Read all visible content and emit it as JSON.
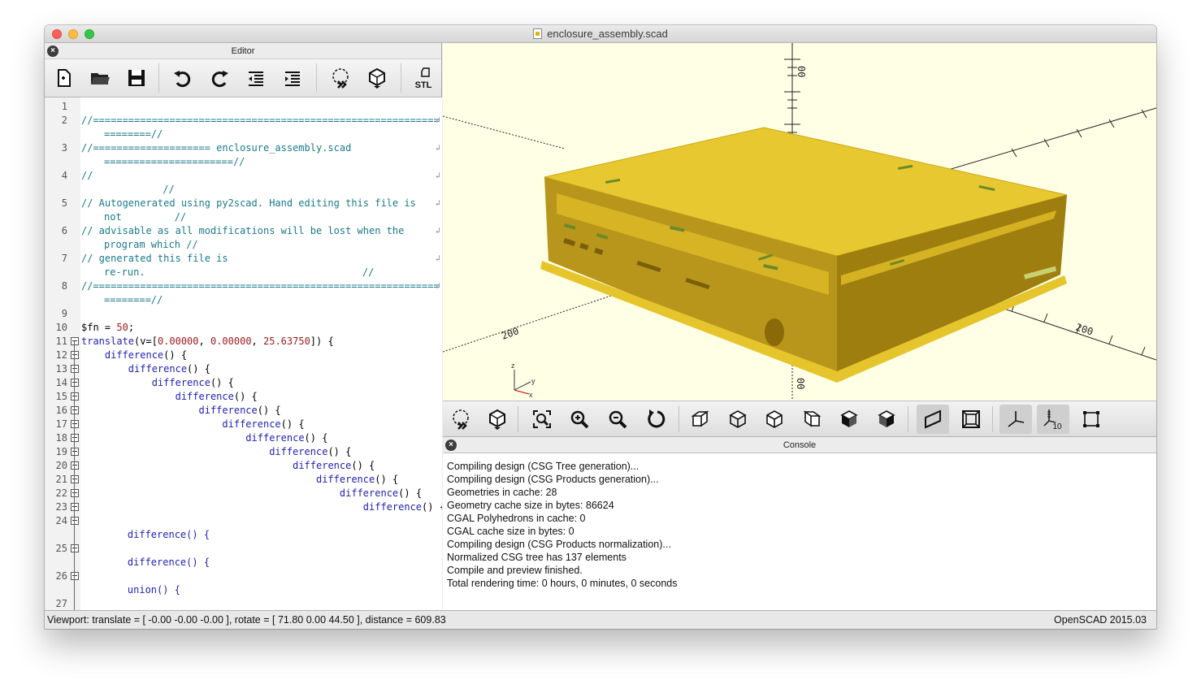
{
  "window": {
    "title": "enclosure_assembly.scad"
  },
  "editor": {
    "header": "Editor",
    "toolbar": [
      {
        "name": "new-file-icon"
      },
      {
        "name": "open-file-icon"
      },
      {
        "name": "save-icon"
      },
      {
        "name": "undo-icon"
      },
      {
        "name": "redo-icon"
      },
      {
        "name": "unindent-icon"
      },
      {
        "name": "indent-icon"
      },
      {
        "name": "preview-icon"
      },
      {
        "name": "render-icon"
      },
      {
        "name": "export-stl-icon",
        "label": "STL"
      }
    ],
    "lines": [
      {
        "n": "1",
        "text": ""
      },
      {
        "n": "2",
        "text": "//===========================================================",
        "cls": "cm",
        "wrap": "========//"
      },
      {
        "n": "3",
        "text": "//==================== enclosure_assembly.scad",
        "cls": "cm",
        "wrap": "======================//"
      },
      {
        "n": "4",
        "text": "//",
        "cls": "cm",
        "wrap": "          //"
      },
      {
        "n": "5",
        "text": "// Autogenerated using py2scad. Hand editing this file is",
        "cls": "cm",
        "wrap": "not         //"
      },
      {
        "n": "6",
        "text": "// advisable as all modifications will be lost when the",
        "cls": "cm",
        "wrap": "program which //"
      },
      {
        "n": "7",
        "text": "// generated this file is",
        "cls": "cm",
        "wrap": "re-run.                                     //"
      },
      {
        "n": "8",
        "text": "//===========================================================",
        "cls": "cm",
        "wrap": "========//"
      },
      {
        "n": "9",
        "text": ""
      },
      {
        "n": "10",
        "text": "$fn = 50;"
      },
      {
        "n": "11",
        "text": "translate(v=[0.00000, 0.00000, 25.63750]) {"
      },
      {
        "n": "12",
        "text": "    difference() {"
      },
      {
        "n": "13",
        "text": "        difference() {"
      },
      {
        "n": "14",
        "text": "            difference() {"
      },
      {
        "n": "15",
        "text": "                difference() {"
      },
      {
        "n": "16",
        "text": "                    difference() {"
      },
      {
        "n": "17",
        "text": "                        difference() {"
      },
      {
        "n": "18",
        "text": "                            difference() {"
      },
      {
        "n": "19",
        "text": "                                difference() {"
      },
      {
        "n": "20",
        "text": "                                    difference() {"
      },
      {
        "n": "21",
        "text": "                                        difference() {"
      },
      {
        "n": "22",
        "text": "                                            difference() {"
      },
      {
        "n": "23",
        "text": "                                                difference() {"
      },
      {
        "n": "24",
        "text": "",
        "wrap": "    difference() {"
      },
      {
        "n": "25",
        "text": "",
        "wrap": "    difference() {"
      },
      {
        "n": "26",
        "text": "",
        "wrap": "    union() {"
      },
      {
        "n": "27",
        "text": ""
      }
    ]
  },
  "viewport": {
    "axis_labels": [
      "00",
      "00",
      "200",
      "200",
      "200"
    ],
    "axes_indicator": {
      "x": "x",
      "y": "y",
      "z": "z"
    },
    "model_color": "#e8c830"
  },
  "view_toolbar": [
    {
      "name": "preview-icon"
    },
    {
      "name": "render-icon"
    },
    {
      "name": "view-all-icon"
    },
    {
      "name": "zoom-in-icon"
    },
    {
      "name": "zoom-out-icon"
    },
    {
      "name": "reset-view-icon"
    },
    {
      "name": "view-right-icon"
    },
    {
      "name": "view-top-icon"
    },
    {
      "name": "view-bottom-icon"
    },
    {
      "name": "view-left-icon"
    },
    {
      "name": "view-front-icon"
    },
    {
      "name": "view-back-icon"
    },
    {
      "name": "perspective-icon"
    },
    {
      "name": "orthogonal-icon"
    },
    {
      "name": "show-axes-icon"
    },
    {
      "name": "show-scale-icon",
      "label": "10"
    },
    {
      "name": "show-edges-icon"
    }
  ],
  "console": {
    "header": "Console",
    "lines": [
      "Compiling design (CSG Tree generation)...",
      "Compiling design (CSG Products generation)...",
      "Geometries in cache: 28",
      "Geometry cache size in bytes: 86624",
      "CGAL Polyhedrons in cache: 0",
      "CGAL cache size in bytes: 0",
      "Compiling design (CSG Products normalization)...",
      "Normalized CSG tree has 137 elements",
      "Compile and preview finished.",
      "Total rendering time: 0 hours, 0 minutes, 0 seconds"
    ]
  },
  "status": {
    "viewport": "Viewport: translate = [ -0.00 -0.00 -0.00 ], rotate = [ 71.80 0.00 44.50 ], distance = 609.83",
    "version": "OpenSCAD 2015.03"
  }
}
